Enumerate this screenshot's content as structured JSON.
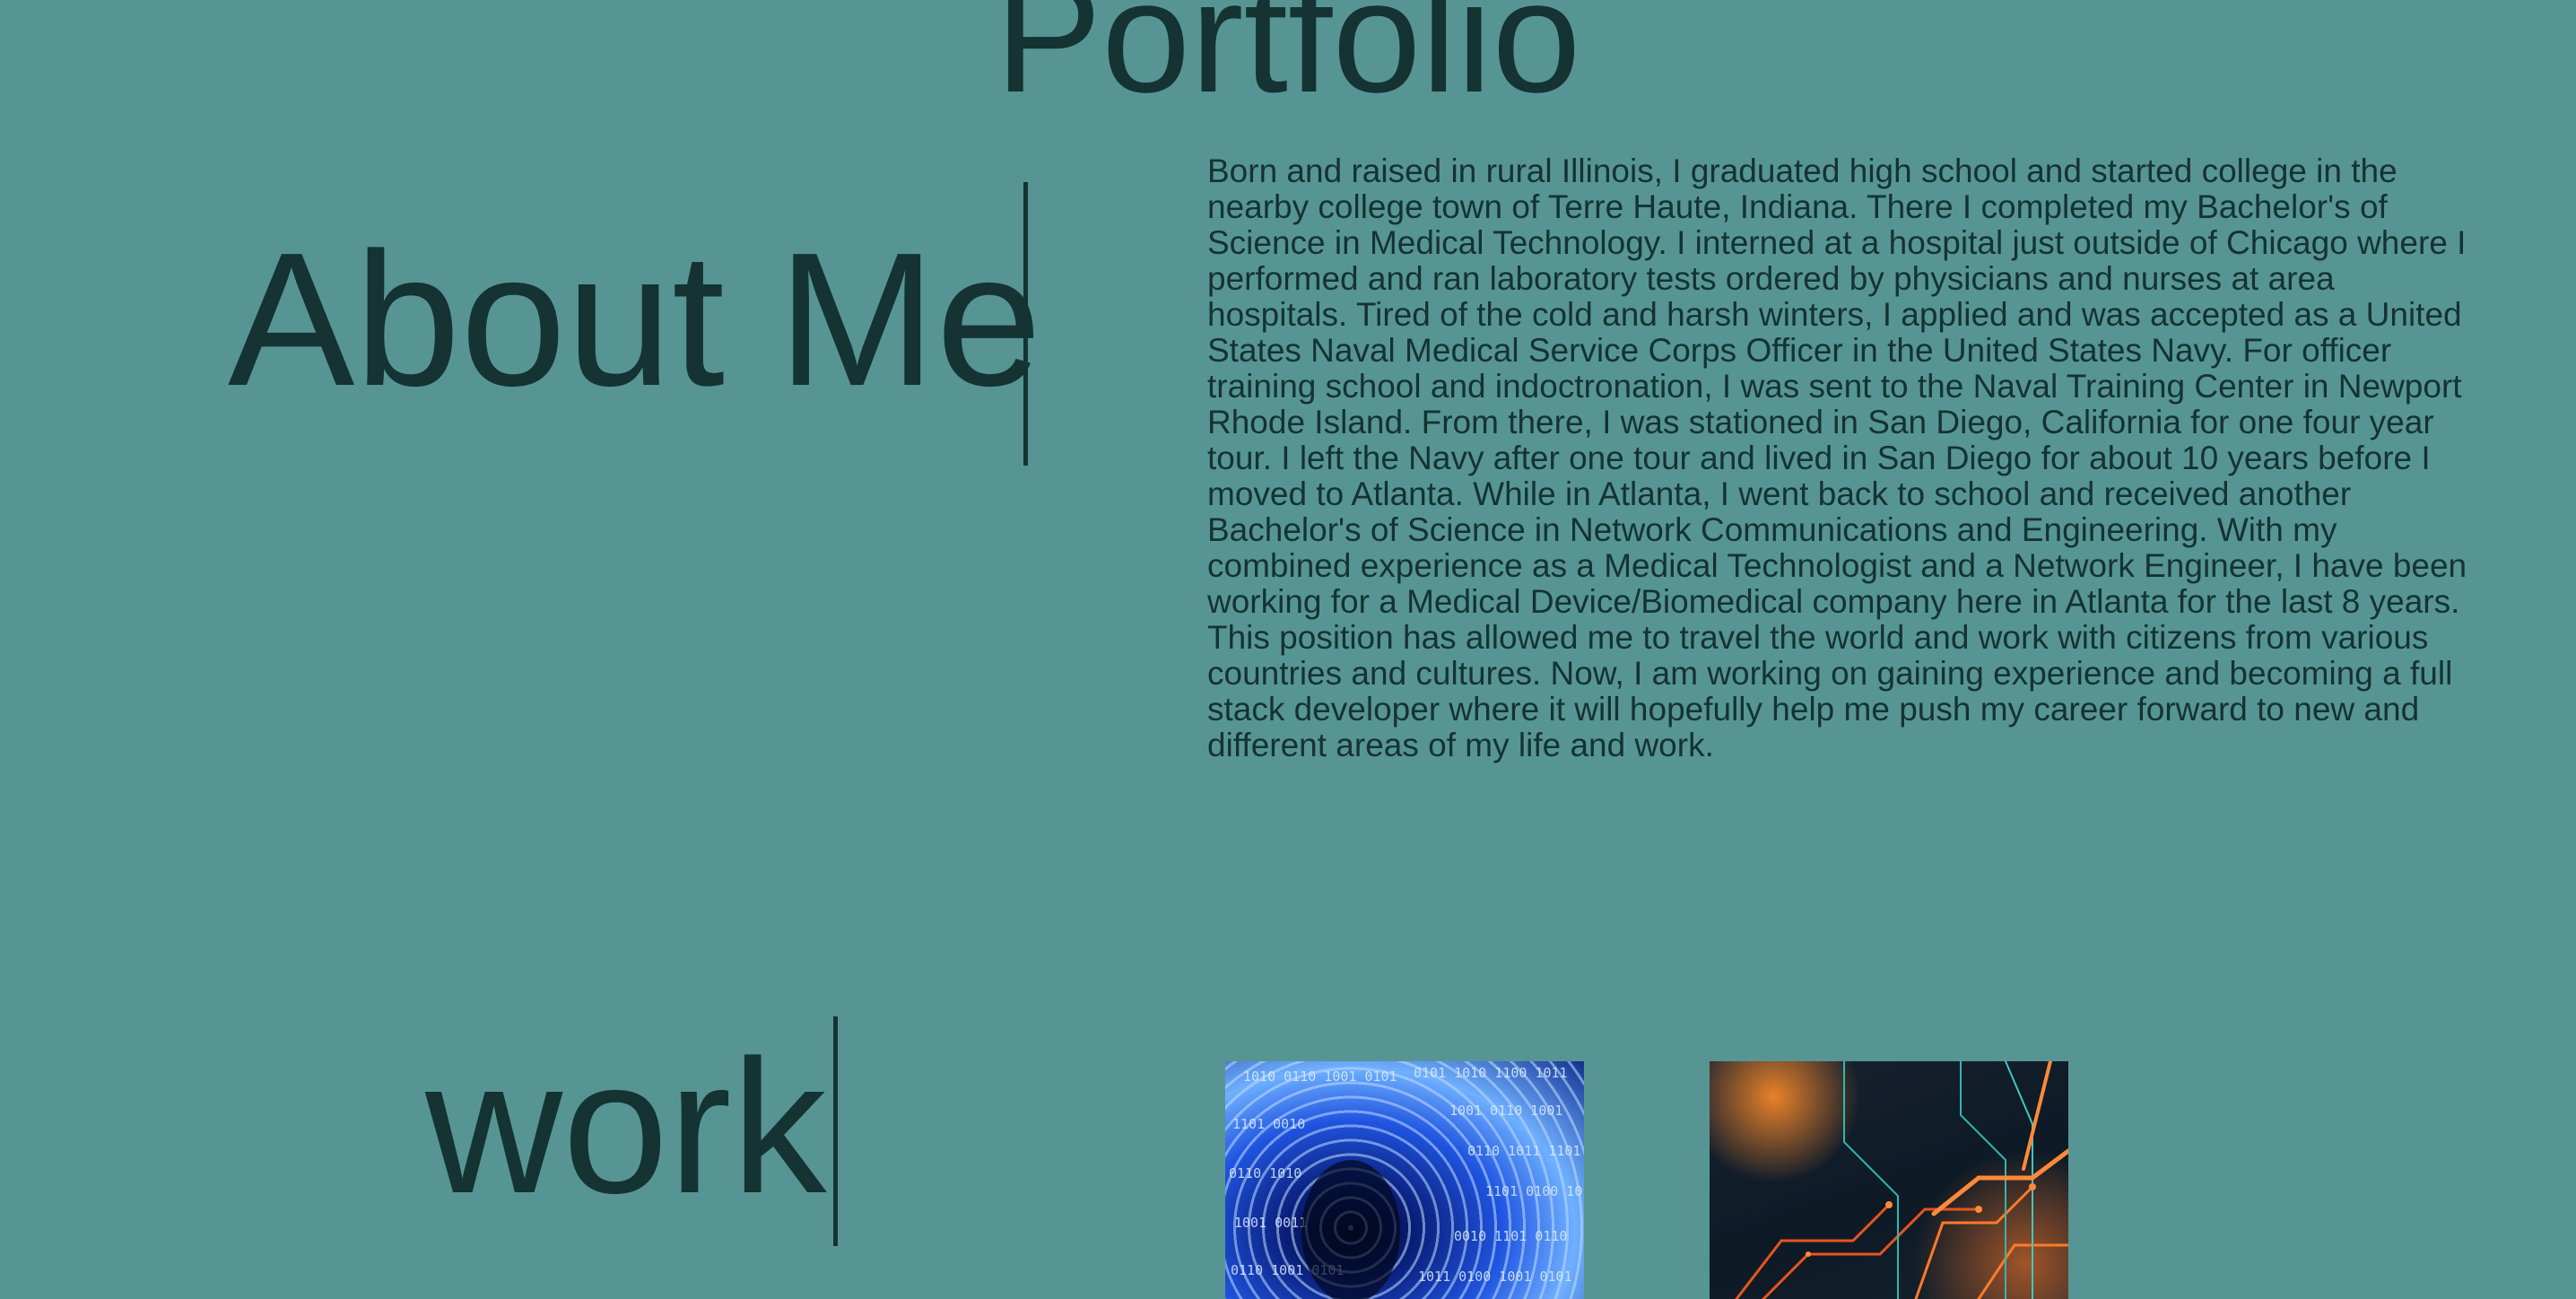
{
  "header": {
    "title": "Portfolio"
  },
  "about": {
    "heading": "About Me",
    "body": "Born and raised in rural Illinois, I graduated high school and started college in the nearby college town of Terre Haute, Indiana. There I completed my Bachelor's of Science in Medical Technology. I interned at a hospital just outside of Chicago where I performed and ran laboratory tests ordered by physicians and nurses at area hospitals. Tired of the cold and harsh winters, I applied and was accepted as a United States Naval Medical Service Corps Officer in the United States Navy. For officer training school and indoctronation, I was sent to the Naval Training Center in Newport Rhode Island. From there, I was stationed in San Diego, California for one four year tour. I left the Navy after one tour and lived in San Diego for about 10 years before I moved to Atlanta. While in Atlanta, I went back to school and received another Bachelor's of Science in Network Communications and Engineering. With my combined experience as a Medical Technologist and a Network Engineer, I have been working for a Medical Device/Biomedical company here in Atlanta for the last 8 years. This position has allowed me to travel the world and work with citizens from various countries and cultures. Now, I am working on gaining experience and becoming a full stack developer where it will hopefully help me push my career forward to new and different areas of my life and work."
  },
  "work": {
    "heading": "work",
    "projects": [
      {
        "image": "binary-tunnel-image"
      },
      {
        "image": "circuit-board-image"
      }
    ]
  },
  "colors": {
    "background": "#579594",
    "text": "#143332"
  }
}
